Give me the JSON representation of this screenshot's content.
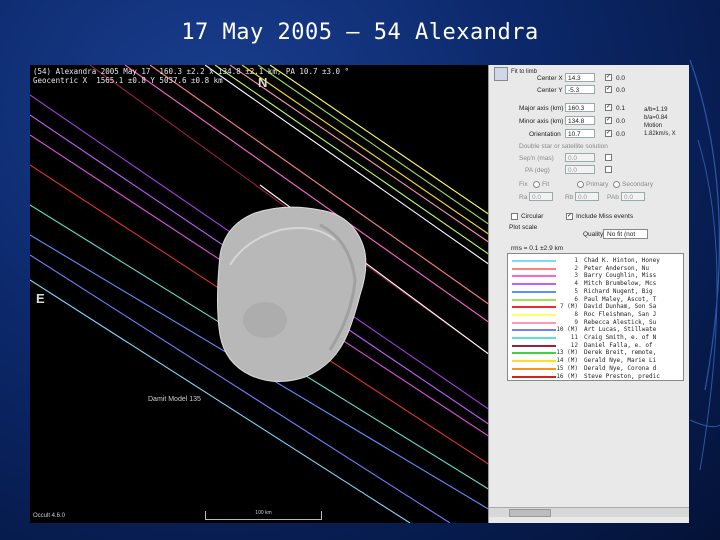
{
  "slide": {
    "title": "17 May 2005 – 54 Alexandra"
  },
  "plot": {
    "header_line1": "(54) Alexandra 2005 May 17  160.3 ±2.2 x 134.8 ±2.1 km, PA 10.7 ±3.0 °",
    "header_line2": "Geocentric X  1565.1 ±0.8 Y 5037.6 ±0.8 km",
    "north": "N",
    "east": "E",
    "model_label": "Damit Model 135",
    "version_label": "Occult 4.6.0",
    "scale_label": "100 km"
  },
  "panel": {
    "tab_label": "Fit to limb",
    "center_x_label": "Center X",
    "center_x_value": "14.3",
    "center_x_step": "0.0",
    "center_y_label": "Center Y",
    "center_y_value": "-5.3",
    "center_y_step": "0.0",
    "major_axis_label": "Major axis (km)",
    "major_axis_value": "160.3",
    "major_axis_step": "0.1",
    "minor_axis_label": "Minor axis (km)",
    "minor_axis_value": "134.8",
    "minor_axis_step": "0.0",
    "orientation_label": "Orientation",
    "orientation_value": "10.7",
    "orientation_step": "0.0",
    "side_line1": "a/b=1.19",
    "side_line2": "b/a=0.84",
    "side_line3": "Motion",
    "side_line4": "1.82km/s, X",
    "double_star_label": "Double star or satellite solution",
    "sep_label": "Sep'n (mas)",
    "sep_value": "0.0",
    "pa_label": "PA (deg)",
    "pa_value": "0.0",
    "fix_label": "Fix",
    "radio1": "Fit",
    "radio2": "Primary",
    "radio3": "Secondary",
    "ra_label": "Ra",
    "ra_value": "0.0",
    "rb_label": "Rb",
    "rb_value": "0.0",
    "pab_label": "PAb",
    "pab_value": "0.0",
    "circular_label": "Circular",
    "include_miss_label": "Include Miss events",
    "plot_scale_label": "Plot scale",
    "quality_label": "Quality",
    "quality_value": "No fit (not",
    "rms_label": "rms = 0.1  ±2.9 km",
    "observers": [
      {
        "num": "1",
        "name": "Chad K. Hinton, Honey",
        "color": "#7fd9ff"
      },
      {
        "num": "2",
        "name": "Peter Anderson, Nu",
        "color": "#ff8080"
      },
      {
        "num": "3",
        "name": "Barry Coughlin, Miss",
        "color": "#ff66cc"
      },
      {
        "num": "4",
        "name": "Mitch Brumbelow, Mcs",
        "color": "#c060ff"
      },
      {
        "num": "5",
        "name": "Richard Nugent, Big",
        "color": "#6090ff"
      },
      {
        "num": "6",
        "name": "Paul Maley, Ascot, T",
        "color": "#9fe05a"
      },
      {
        "num": "7 (M)",
        "name": "David Dunham, Son Sa",
        "color": "#e03030"
      },
      {
        "num": "8",
        "name": "Roc Fleishman, San J",
        "color": "#ffff60"
      },
      {
        "num": "9",
        "name": "Rebecca Alestick, Su",
        "color": "#ff9ab0"
      },
      {
        "num": "10 (M)",
        "name": "Art Lucas, Stillwate",
        "color": "#7080ff"
      },
      {
        "num": "11",
        "name": "Craig Smith, e. of N",
        "color": "#60e0d0"
      },
      {
        "num": "12",
        "name": "Daniel Falla, e. of",
        "color": "#9b2040"
      },
      {
        "num": "13 (M)",
        "name": "Derek Breit, remote,",
        "color": "#40d040"
      },
      {
        "num": "14 (M)",
        "name": "Gerald Nye, Marie Li",
        "color": "#ffe020"
      },
      {
        "num": "15 (M)",
        "name": "Derald Nye, Corona d",
        "color": "#ff9020"
      },
      {
        "num": "16 (M)",
        "name": "Steve Preston, predic",
        "color": "#d02020"
      }
    ]
  }
}
